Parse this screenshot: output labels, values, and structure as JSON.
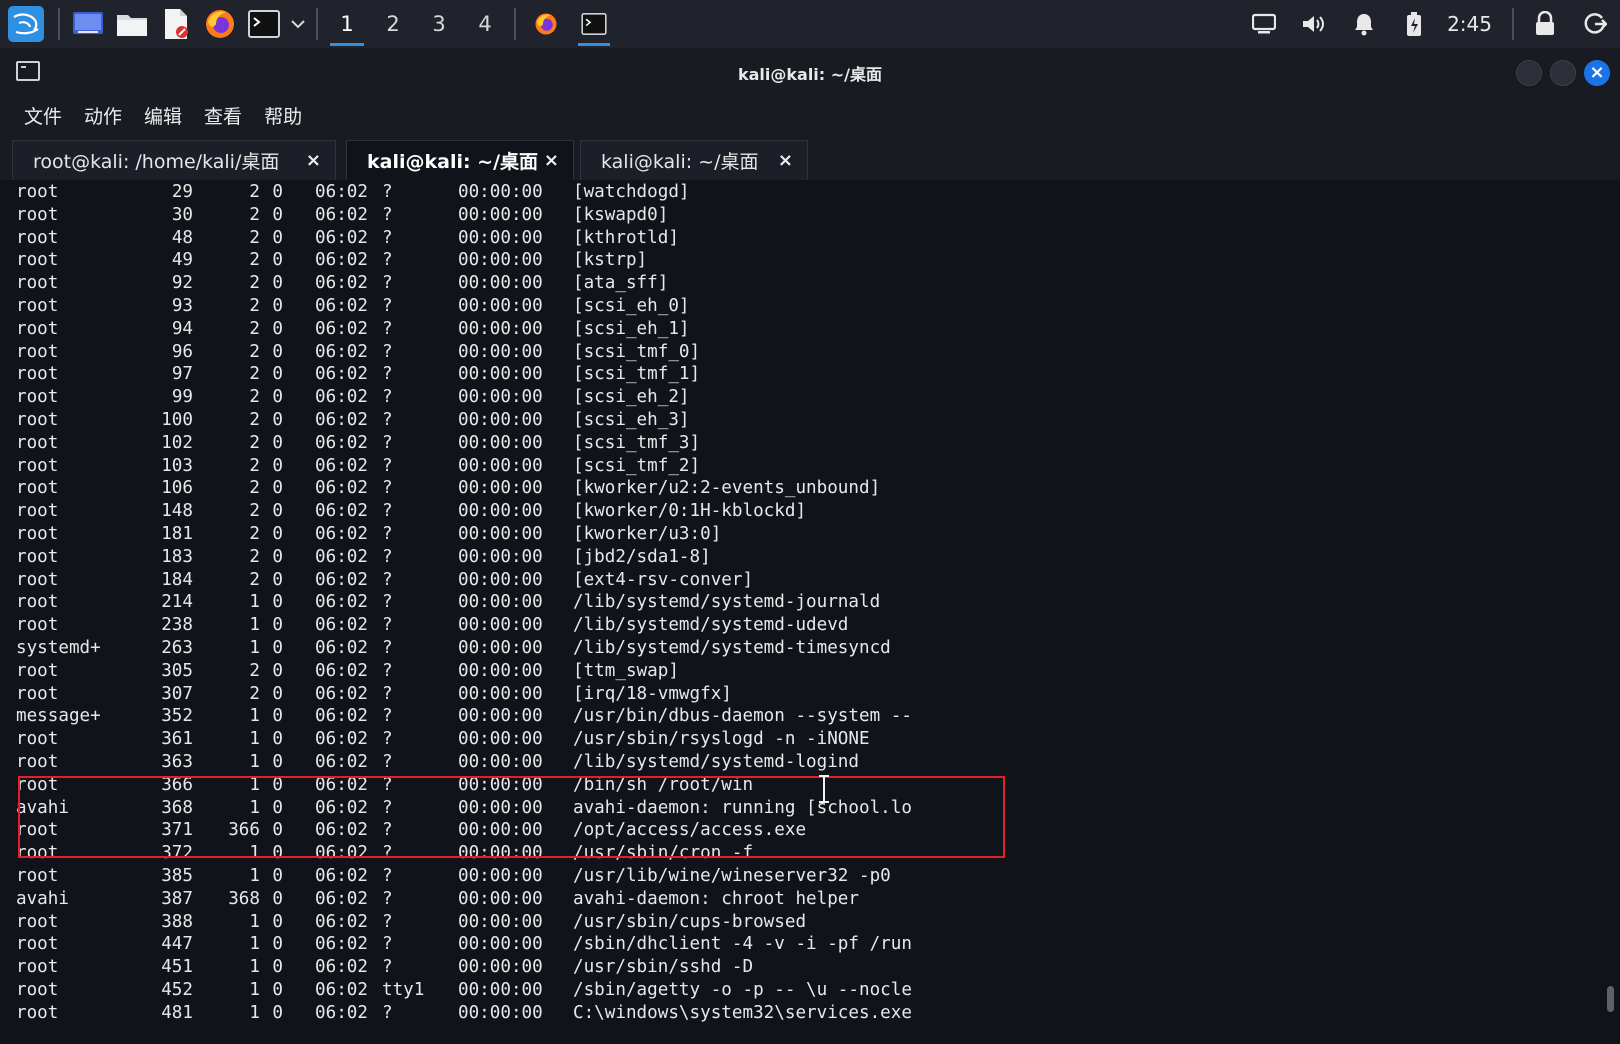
{
  "panel": {
    "workspaces": [
      "1",
      "2",
      "3",
      "4"
    ],
    "active_workspace": "1",
    "clock": "2:45"
  },
  "window": {
    "title": "kali@kali: ~/桌面"
  },
  "menu": [
    "文件",
    "动作",
    "编辑",
    "查看",
    "帮助"
  ],
  "tabs": [
    {
      "label": "root@kali: /home/kali/桌面",
      "close": "×"
    },
    {
      "label": "kali@kali: ~/桌面",
      "close": "×"
    },
    {
      "label": "kali@kali: ~/桌面",
      "close": "×"
    }
  ],
  "active_tab": 1,
  "processes": [
    {
      "user": "root",
      "pid": "29",
      "ppid": "2",
      "c": "0",
      "stime": "06:02",
      "tty": "?",
      "time": "00:00:00",
      "cmd": "[watchdogd]"
    },
    {
      "user": "root",
      "pid": "30",
      "ppid": "2",
      "c": "0",
      "stime": "06:02",
      "tty": "?",
      "time": "00:00:00",
      "cmd": "[kswapd0]"
    },
    {
      "user": "root",
      "pid": "48",
      "ppid": "2",
      "c": "0",
      "stime": "06:02",
      "tty": "?",
      "time": "00:00:00",
      "cmd": "[kthrotld]"
    },
    {
      "user": "root",
      "pid": "49",
      "ppid": "2",
      "c": "0",
      "stime": "06:02",
      "tty": "?",
      "time": "00:00:00",
      "cmd": "[kstrp]"
    },
    {
      "user": "root",
      "pid": "92",
      "ppid": "2",
      "c": "0",
      "stime": "06:02",
      "tty": "?",
      "time": "00:00:00",
      "cmd": "[ata_sff]"
    },
    {
      "user": "root",
      "pid": "93",
      "ppid": "2",
      "c": "0",
      "stime": "06:02",
      "tty": "?",
      "time": "00:00:00",
      "cmd": "[scsi_eh_0]"
    },
    {
      "user": "root",
      "pid": "94",
      "ppid": "2",
      "c": "0",
      "stime": "06:02",
      "tty": "?",
      "time": "00:00:00",
      "cmd": "[scsi_eh_1]"
    },
    {
      "user": "root",
      "pid": "96",
      "ppid": "2",
      "c": "0",
      "stime": "06:02",
      "tty": "?",
      "time": "00:00:00",
      "cmd": "[scsi_tmf_0]"
    },
    {
      "user": "root",
      "pid": "97",
      "ppid": "2",
      "c": "0",
      "stime": "06:02",
      "tty": "?",
      "time": "00:00:00",
      "cmd": "[scsi_tmf_1]"
    },
    {
      "user": "root",
      "pid": "99",
      "ppid": "2",
      "c": "0",
      "stime": "06:02",
      "tty": "?",
      "time": "00:00:00",
      "cmd": "[scsi_eh_2]"
    },
    {
      "user": "root",
      "pid": "100",
      "ppid": "2",
      "c": "0",
      "stime": "06:02",
      "tty": "?",
      "time": "00:00:00",
      "cmd": "[scsi_eh_3]"
    },
    {
      "user": "root",
      "pid": "102",
      "ppid": "2",
      "c": "0",
      "stime": "06:02",
      "tty": "?",
      "time": "00:00:00",
      "cmd": "[scsi_tmf_3]"
    },
    {
      "user": "root",
      "pid": "103",
      "ppid": "2",
      "c": "0",
      "stime": "06:02",
      "tty": "?",
      "time": "00:00:00",
      "cmd": "[scsi_tmf_2]"
    },
    {
      "user": "root",
      "pid": "106",
      "ppid": "2",
      "c": "0",
      "stime": "06:02",
      "tty": "?",
      "time": "00:00:00",
      "cmd": "[kworker/u2:2-events_unbound]"
    },
    {
      "user": "root",
      "pid": "148",
      "ppid": "2",
      "c": "0",
      "stime": "06:02",
      "tty": "?",
      "time": "00:00:00",
      "cmd": "[kworker/0:1H-kblockd]"
    },
    {
      "user": "root",
      "pid": "181",
      "ppid": "2",
      "c": "0",
      "stime": "06:02",
      "tty": "?",
      "time": "00:00:00",
      "cmd": "[kworker/u3:0]"
    },
    {
      "user": "root",
      "pid": "183",
      "ppid": "2",
      "c": "0",
      "stime": "06:02",
      "tty": "?",
      "time": "00:00:00",
      "cmd": "[jbd2/sda1-8]"
    },
    {
      "user": "root",
      "pid": "184",
      "ppid": "2",
      "c": "0",
      "stime": "06:02",
      "tty": "?",
      "time": "00:00:00",
      "cmd": "[ext4-rsv-conver]"
    },
    {
      "user": "root",
      "pid": "214",
      "ppid": "1",
      "c": "0",
      "stime": "06:02",
      "tty": "?",
      "time": "00:00:00",
      "cmd": "/lib/systemd/systemd-journald"
    },
    {
      "user": "root",
      "pid": "238",
      "ppid": "1",
      "c": "0",
      "stime": "06:02",
      "tty": "?",
      "time": "00:00:00",
      "cmd": "/lib/systemd/systemd-udevd"
    },
    {
      "user": "systemd+",
      "pid": "263",
      "ppid": "1",
      "c": "0",
      "stime": "06:02",
      "tty": "?",
      "time": "00:00:00",
      "cmd": "/lib/systemd/systemd-timesyncd"
    },
    {
      "user": "root",
      "pid": "305",
      "ppid": "2",
      "c": "0",
      "stime": "06:02",
      "tty": "?",
      "time": "00:00:00",
      "cmd": "[ttm_swap]"
    },
    {
      "user": "root",
      "pid": "307",
      "ppid": "2",
      "c": "0",
      "stime": "06:02",
      "tty": "?",
      "time": "00:00:00",
      "cmd": "[irq/18-vmwgfx]"
    },
    {
      "user": "message+",
      "pid": "352",
      "ppid": "1",
      "c": "0",
      "stime": "06:02",
      "tty": "?",
      "time": "00:00:00",
      "cmd": "/usr/bin/dbus-daemon --system --"
    },
    {
      "user": "root",
      "pid": "361",
      "ppid": "1",
      "c": "0",
      "stime": "06:02",
      "tty": "?",
      "time": "00:00:00",
      "cmd": "/usr/sbin/rsyslogd -n -iNONE"
    },
    {
      "user": "root",
      "pid": "363",
      "ppid": "1",
      "c": "0",
      "stime": "06:02",
      "tty": "?",
      "time": "00:00:00",
      "cmd": "/lib/systemd/systemd-logind"
    },
    {
      "user": "root",
      "pid": "366",
      "ppid": "1",
      "c": "0",
      "stime": "06:02",
      "tty": "?",
      "time": "00:00:00",
      "cmd": "/bin/sh /root/win"
    },
    {
      "user": "avahi",
      "pid": "368",
      "ppid": "1",
      "c": "0",
      "stime": "06:02",
      "tty": "?",
      "time": "00:00:00",
      "cmd": "avahi-daemon: running [school.lo"
    },
    {
      "user": "root",
      "pid": "371",
      "ppid": "366",
      "c": "0",
      "stime": "06:02",
      "tty": "?",
      "time": "00:00:00",
      "cmd": "/opt/access/access.exe"
    },
    {
      "user": "root",
      "pid": "372",
      "ppid": "1",
      "c": "0",
      "stime": "06:02",
      "tty": "?",
      "time": "00:00:00",
      "cmd": "/usr/sbin/cron -f"
    },
    {
      "user": "root",
      "pid": "385",
      "ppid": "1",
      "c": "0",
      "stime": "06:02",
      "tty": "?",
      "time": "00:00:00",
      "cmd": "/usr/lib/wine/wineserver32 -p0"
    },
    {
      "user": "avahi",
      "pid": "387",
      "ppid": "368",
      "c": "0",
      "stime": "06:02",
      "tty": "?",
      "time": "00:00:00",
      "cmd": "avahi-daemon: chroot helper"
    },
    {
      "user": "root",
      "pid": "388",
      "ppid": "1",
      "c": "0",
      "stime": "06:02",
      "tty": "?",
      "time": "00:00:00",
      "cmd": "/usr/sbin/cups-browsed"
    },
    {
      "user": "root",
      "pid": "447",
      "ppid": "1",
      "c": "0",
      "stime": "06:02",
      "tty": "?",
      "time": "00:00:00",
      "cmd": "/sbin/dhclient -4 -v -i -pf /run"
    },
    {
      "user": "root",
      "pid": "451",
      "ppid": "1",
      "c": "0",
      "stime": "06:02",
      "tty": "?",
      "time": "00:00:00",
      "cmd": "/usr/sbin/sshd -D"
    },
    {
      "user": "root",
      "pid": "452",
      "ppid": "1",
      "c": "0",
      "stime": "06:02",
      "tty": "tty1",
      "time": "00:00:00",
      "cmd": "/sbin/agetty -o -p -- \\u --nocle"
    },
    {
      "user": "root",
      "pid": "481",
      "ppid": "1",
      "c": "0",
      "stime": "06:02",
      "tty": "?",
      "time": "00:00:00",
      "cmd": "C:\\windows\\system32\\services.exe"
    }
  ],
  "highlight_color": "#e2202a",
  "accent_color": "#2f8fe0"
}
